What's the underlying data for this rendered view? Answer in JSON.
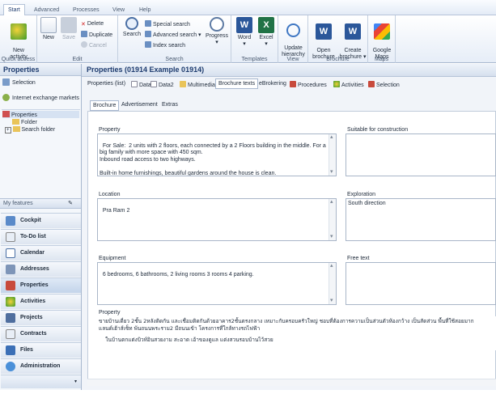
{
  "ribbon_tabs": [
    "Start",
    "Advanced",
    "Processes",
    "View",
    "Help"
  ],
  "groups": {
    "quick_access": {
      "label": "Quick access",
      "new_activity": "New\nactivity"
    },
    "edit": {
      "label": "Edit",
      "new": "New",
      "save": "Save",
      "delete": "Delete",
      "duplicate": "Duplicate",
      "cancel": "Cancel"
    },
    "search": {
      "label": "Search",
      "search": "Search",
      "special_search": "Special search",
      "advanced_search": "Advanced search",
      "index_search": "Index search",
      "progress": "Progress"
    },
    "templates": {
      "label": "Templates",
      "word": "Word",
      "excel": "Excel"
    },
    "view": {
      "label": "View",
      "update_hierarchy": "Update\nhierarchy"
    },
    "brochure": {
      "label": "Brochure",
      "open_brochure": "Open\nbrochure",
      "create_brochure": "Create\nbrochure"
    },
    "maps": {
      "label": "Maps",
      "google_maps": "Google\nMaps"
    }
  },
  "left": {
    "title": "Properties",
    "selection": "Selection",
    "internet_markets": "Internet exchange markets",
    "tree": {
      "properties": "Properties",
      "folder": "Folder",
      "search_folder": "Search folder"
    },
    "my_features": "My features",
    "nav": [
      "Cockpit",
      "To-Do list",
      "Calendar",
      "Addresses",
      "Properties",
      "Activities",
      "Projects",
      "Contracts",
      "Files",
      "Administration"
    ]
  },
  "main": {
    "title": "Properties (01914 Example  01914)",
    "tabs": [
      "Properties (list)",
      "Data1",
      "Data2",
      "Multimedia",
      "Brochure texts",
      "eBrokering",
      "Procedures",
      "Activities",
      "Selection"
    ],
    "subtabs": [
      "Brochure",
      "Advertisement",
      "Extras"
    ],
    "fields": {
      "property": {
        "label": "Property",
        "value": "For Sale:  2 units with 2 floors, each connected by a 2 Floors building in the middle. For a big family with more space with 450 sqm.\nInbound road access to two highways.\n\nBuilt-in home furnishings, beautiful gardens around the house is clean.\nBackyard garden in the village the is open"
      },
      "suitable": {
        "label": "Suitable for construction",
        "value": ""
      },
      "location": {
        "label": "Location",
        "value": "Pra Ram 2"
      },
      "exploration": {
        "label": "Exploration",
        "value": "South direction"
      },
      "equipment": {
        "label": "Equipment",
        "value": "6 bedrooms, 6 bathrooms, 2 living rooms 3 rooms 4 parking."
      },
      "free_text": {
        "label": "Free text",
        "value": ""
      },
      "property_thai": {
        "label": "Property",
        "line1": "ขายบ้านเดี่ยว 2ชั้น 2หลังติดกัน และเชื่อมติดกันด้วยอาคาร2ชั้นตรงกลาง เหมาะกับครอบครัวใหญ่ ชอบที่ต้องการความเป็นส่วนตัวห้องกว้าง เป็นสัดส่วน พื้นที่ใช้สอยมาก",
        "line2": "แลนด์เฮ้าส์เซ็ท พ้นถนนพระราม2 มีถนนเข้า โครงการที่ใกล้ทางรถไฟฟ้า",
        "line3": "    ในบ้านตกแต่งบิวท์อินสวยงาม สะอาด เอ้าของดูแล แต่งสวนรอบบ้านไว้สวย"
      }
    }
  },
  "colors": {
    "accent": "#1d3b6e",
    "ribbon_border": "#a8b8cf"
  }
}
